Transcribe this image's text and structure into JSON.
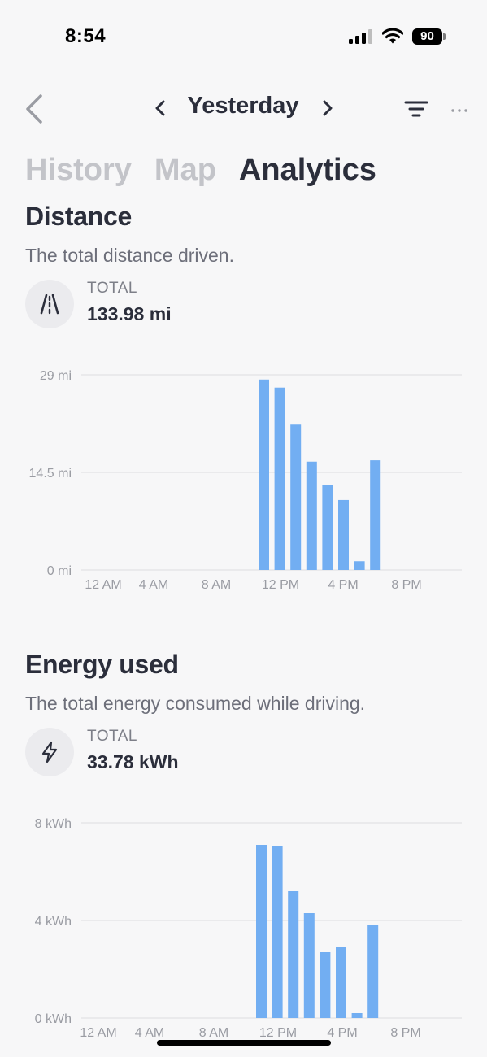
{
  "status_bar": {
    "time": "8:54",
    "battery": "90",
    "icons": [
      "cellular-signal-icon",
      "wifi-icon",
      "battery-icon"
    ]
  },
  "nav": {
    "date_title": "Yesterday",
    "icons": [
      "back-chevron-icon",
      "prev-chevron-icon",
      "next-chevron-icon",
      "filter-icon",
      "more-icon"
    ]
  },
  "tabs": [
    {
      "label": "History",
      "active": false
    },
    {
      "label": "Map",
      "active": false
    },
    {
      "label": "Analytics",
      "active": true
    }
  ],
  "distance": {
    "title": "Distance",
    "description": "The total distance driven.",
    "total_label": "TOTAL",
    "total_value": "133.98 mi",
    "icon": "road-icon"
  },
  "energy": {
    "title": "Energy used",
    "description": "The total energy consumed while driving.",
    "total_label": "TOTAL",
    "total_value": "33.78 kWh",
    "icon": "lightning-icon"
  },
  "colors": {
    "accent": "#72aef2",
    "text_primary": "#2b2e3b",
    "text_muted": "#6d6f7a",
    "tab_inactive": "#c3c4c9",
    "background": "#f7f7f8"
  },
  "chart_data": [
    {
      "type": "bar",
      "x": [
        "11 AM",
        "12 PM",
        "1 PM",
        "2 PM",
        "3 PM",
        "4 PM",
        "5 PM",
        "6 PM"
      ],
      "values": [
        28.3,
        27.1,
        21.6,
        16.1,
        12.6,
        10.4,
        1.3,
        16.3
      ],
      "xticks": [
        "12 AM",
        "4 AM",
        "8 AM",
        "12 PM",
        "4 PM",
        "8 PM"
      ],
      "yticks": [
        "0 mi",
        "14.5 mi",
        "29 mi"
      ],
      "ylim": [
        0,
        29
      ],
      "grid": true
    },
    {
      "type": "bar",
      "x": [
        "11 AM",
        "12 PM",
        "1 PM",
        "2 PM",
        "3 PM",
        "4 PM",
        "5 PM",
        "6 PM"
      ],
      "values": [
        7.1,
        7.05,
        5.2,
        4.3,
        2.7,
        2.9,
        0.2,
        3.8
      ],
      "xticks": [
        "12 AM",
        "4 AM",
        "8 AM",
        "12 PM",
        "4 PM",
        "8 PM"
      ],
      "yticks": [
        "0 kWh",
        "4 kWh",
        "8 kWh"
      ],
      "ylim": [
        0,
        8
      ],
      "grid": true
    }
  ]
}
